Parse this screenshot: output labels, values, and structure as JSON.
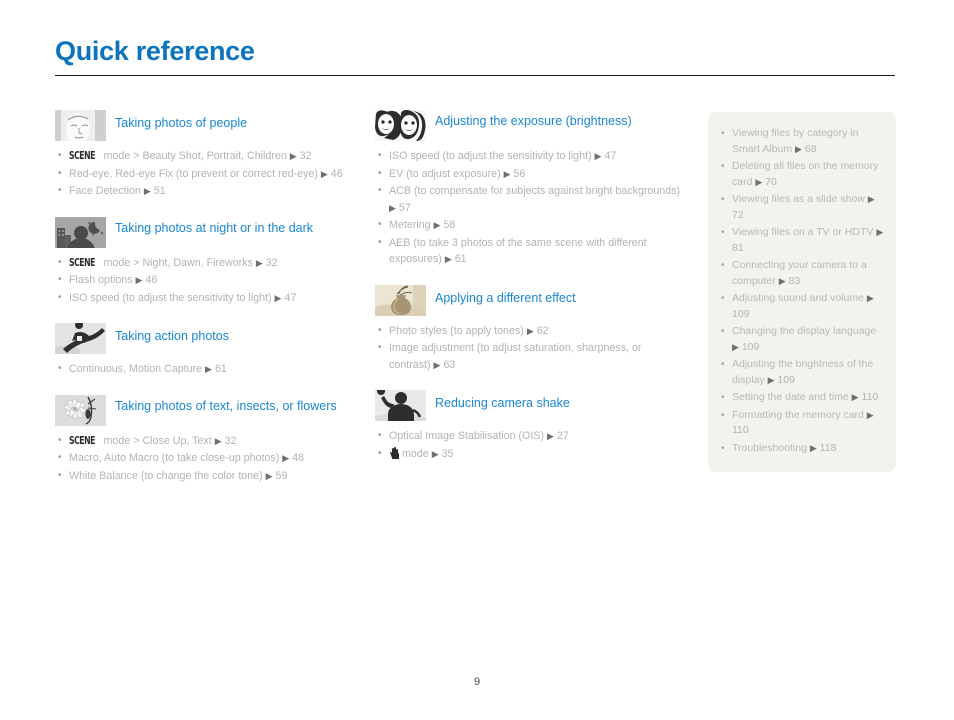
{
  "document": {
    "title": "Quick reference",
    "page_number": "9",
    "accent_color": "#0b74bd",
    "heading_color": "#1a87ce",
    "body_text_color": "#b3b3b3",
    "panel_background": "#f2f2ee"
  },
  "columns": {
    "left": [
      {
        "icon": "portrait-face-thumbnail",
        "title": "Taking photos of people",
        "items": [
          {
            "glyph": "SCENE",
            "text": " mode > Beauty Shot, Portrait, Children ",
            "arrow": "▶",
            "page": "32"
          },
          {
            "glyph": "",
            "text": "Red-eye, Red-eye Fix (to prevent or correct red-eye) ",
            "arrow": "▶",
            "page": "46"
          },
          {
            "glyph": "",
            "text": "Face Detection ",
            "arrow": "▶",
            "page": "51"
          }
        ]
      },
      {
        "icon": "night-silhouette-thumbnail",
        "title": "Taking photos at night or in the dark",
        "items": [
          {
            "glyph": "SCENE",
            "text": " mode > Night, Dawn, Fireworks ",
            "arrow": "▶",
            "page": "32"
          },
          {
            "glyph": "",
            "text": "Flash options ",
            "arrow": "▶",
            "page": "46"
          },
          {
            "glyph": "",
            "text": "ISO speed (to adjust the sensitivity to light) ",
            "arrow": "▶",
            "page": "47"
          }
        ]
      },
      {
        "icon": "snowboarder-action-thumbnail",
        "title": "Taking action photos",
        "items": [
          {
            "glyph": "",
            "text": "Continuous, Motion Capture ",
            "arrow": "▶",
            "page": "61"
          }
        ]
      },
      {
        "icon": "flower-macro-thumbnail",
        "title": "Taking photos of text, insects, or flowers",
        "items": [
          {
            "glyph": "SCENE",
            "text": " mode > Close Up, Text ",
            "arrow": "▶",
            "page": "32"
          },
          {
            "glyph": "",
            "text": "Macro, Auto Macro (to take close-up photos) ",
            "arrow": "▶",
            "page": "48"
          },
          {
            "glyph": "",
            "text": "White Balance (to change the color tone) ",
            "arrow": "▶",
            "page": "59"
          }
        ]
      }
    ],
    "middle": [
      {
        "icon": "two-faces-contrast-thumbnail",
        "title": "Adjusting the exposure (brightness)",
        "items": [
          {
            "glyph": "",
            "text": "ISO speed (to adjust the sensitivity to light) ",
            "arrow": "▶",
            "page": "47"
          },
          {
            "glyph": "",
            "text": "EV (to adjust exposure) ",
            "arrow": "▶",
            "page": "56"
          },
          {
            "glyph": "",
            "text": "ACB (to compensate for subjects against bright backgrounds) ",
            "arrow": "▶",
            "page": "57"
          },
          {
            "glyph": "",
            "text": "Metering ",
            "arrow": "▶",
            "page": "58"
          },
          {
            "glyph": "",
            "text": "AEB (to take 3 photos of the same scene with different exposures) ",
            "arrow": "▶",
            "page": "61"
          }
        ]
      },
      {
        "icon": "sepia-vase-thumbnail",
        "title": "Applying a different effect",
        "items": [
          {
            "glyph": "",
            "text": "Photo styles (to apply tones) ",
            "arrow": "▶",
            "page": "62"
          },
          {
            "glyph": "",
            "text": "Image adjustment (to adjust saturation, sharpness, or contrast) ",
            "arrow": "▶",
            "page": "63"
          }
        ]
      },
      {
        "icon": "shaking-hand-person-thumbnail",
        "title": "Reducing camera shake",
        "items": [
          {
            "glyph": "",
            "text": "Optical Image Stabilisation (OIS) ",
            "arrow": "▶",
            "page": "27"
          },
          {
            "glyph": "DUAL-IS-HAND",
            "text": "mode ",
            "arrow": "▶",
            "page": "35"
          }
        ]
      }
    ],
    "right": [
      {
        "text": "Viewing files by category in Smart Album ",
        "arrow": "▶",
        "page": "68"
      },
      {
        "text": "Deleting all files on the memory card ",
        "arrow": "▶",
        "page": "70"
      },
      {
        "text": "Viewing files as a slide show ",
        "arrow": "▶",
        "page": "72"
      },
      {
        "text": "Viewing files on a TV or HDTV ",
        "arrow": "▶",
        "page": "81"
      },
      {
        "text": "Connecting your camera to a computer ",
        "arrow": "▶",
        "page": "83"
      },
      {
        "text": "Adjusting sound and volume ",
        "arrow": "▶",
        "page": "109"
      },
      {
        "text": "Changing the display language ",
        "arrow": "▶",
        "page": "109"
      },
      {
        "text": "Adjusting the brightness of the display ",
        "arrow": "▶",
        "page": "109"
      },
      {
        "text": "Setting the date and time ",
        "arrow": "▶",
        "page": "110"
      },
      {
        "text": "Formatting the memory card ",
        "arrow": "▶",
        "page": "110"
      },
      {
        "text": "Troubleshooting ",
        "arrow": "▶",
        "page": "118"
      }
    ]
  }
}
